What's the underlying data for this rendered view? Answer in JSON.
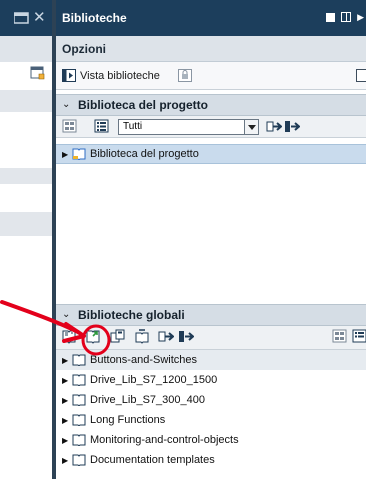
{
  "panel": {
    "title": "Biblioteche",
    "options_label": "Opzioni",
    "vista_label": "Vista biblioteche"
  },
  "project_library": {
    "header": "Biblioteca del progetto",
    "filter_value": "Tutti",
    "items": [
      {
        "label": "Biblioteca del progetto",
        "selected": true
      }
    ]
  },
  "global_libraries": {
    "header": "Biblioteche globali",
    "items": [
      {
        "label": "Buttons-and-Switches"
      },
      {
        "label": "Drive_Lib_S7_1200_1500"
      },
      {
        "label": "Drive_Lib_S7_300_400"
      },
      {
        "label": "Long Functions"
      },
      {
        "label": "Monitoring-and-control-objects"
      },
      {
        "label": "Documentation templates"
      }
    ]
  },
  "colors": {
    "title_bar": "#1c3e5c",
    "annotation": "#e3001b",
    "selection": "#c9dbed"
  },
  "icons": {
    "collapse": "chevron-down-icon",
    "expand": "triangle-right-icon",
    "library": "book-icon",
    "annotation": "red-arrow-and-circle"
  }
}
